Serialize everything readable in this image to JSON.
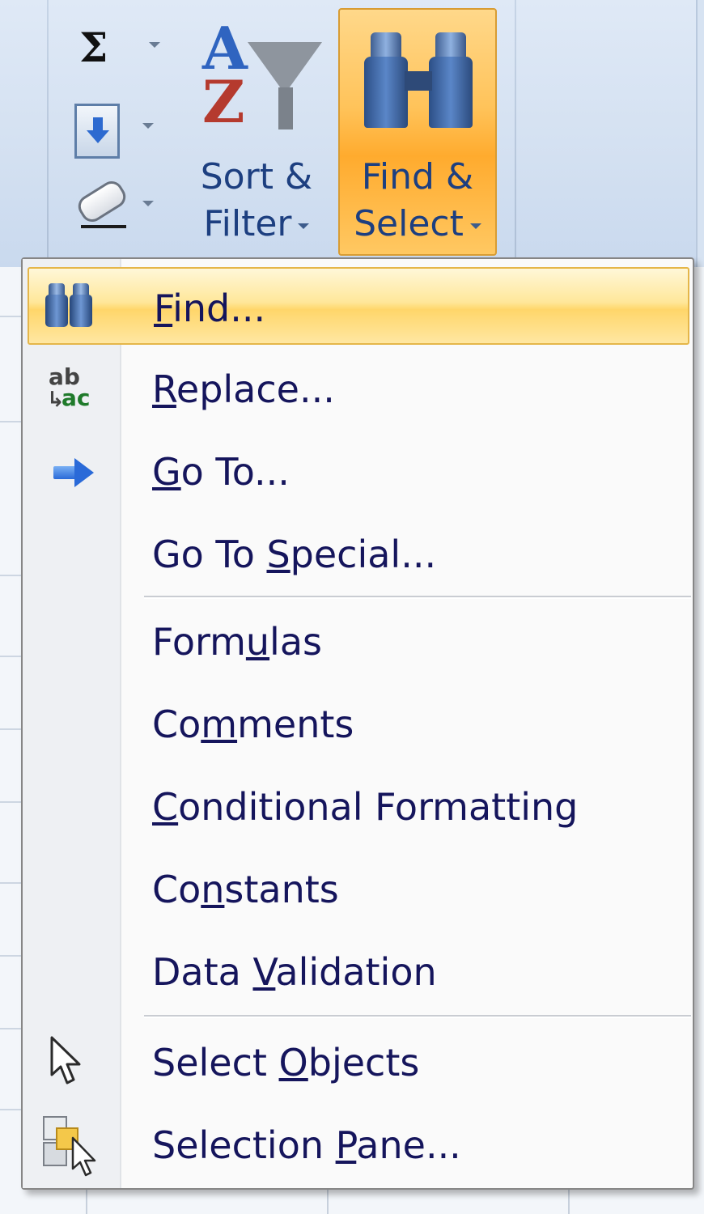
{
  "ribbon": {
    "sigma_symbol": "Σ",
    "sort_filter": {
      "line1": "Sort &",
      "line2": "Filter"
    },
    "find_select": {
      "line1": "Find &",
      "line2": "Select"
    },
    "sort_icon_letters": {
      "a": "A",
      "z": "Z"
    }
  },
  "menu": {
    "items": [
      {
        "mnemonic": "F",
        "rest": "ind...",
        "icon": "binoculars-icon",
        "highlighted": true
      },
      {
        "mnemonic": "R",
        "rest": "eplace...",
        "icon": "replace-icon"
      },
      {
        "mnemonic": "G",
        "rest": "o To...",
        "icon": "arrow-right-icon"
      },
      {
        "pre": "Go To ",
        "mnemonic": "S",
        "rest": "pecial..."
      },
      {
        "pre": "Form",
        "mnemonic": "u",
        "rest": "las"
      },
      {
        "pre": "Co",
        "mnemonic": "m",
        "rest": "ments"
      },
      {
        "mnemonic": "C",
        "rest": "onditional Formatting"
      },
      {
        "pre": "Co",
        "mnemonic": "n",
        "rest": "stants"
      },
      {
        "pre": "Data ",
        "mnemonic": "V",
        "rest": "alidation"
      },
      {
        "pre": "Select ",
        "mnemonic": "O",
        "rest": "bjects",
        "icon": "cursor-icon"
      },
      {
        "pre": "Selection ",
        "mnemonic": "P",
        "rest": "ane...",
        "icon": "selection-pane-icon"
      }
    ],
    "icon_text": {
      "replace_top": "ab",
      "replace_bottom": "ac",
      "replace_hook": "↳"
    }
  },
  "colors": {
    "menu_text": "#15155c",
    "highlight": "#ffd66a",
    "find_button": "#ffab2e"
  }
}
